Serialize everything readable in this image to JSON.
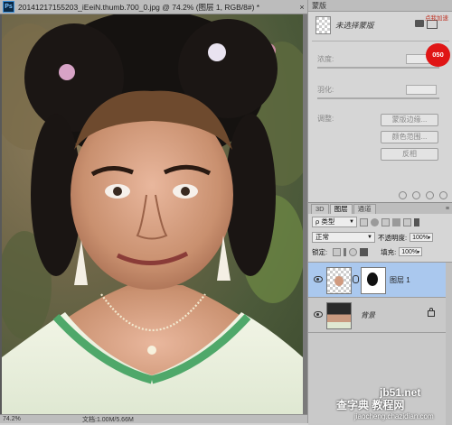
{
  "document": {
    "title": "20141217155203_iEeiN.thumb.700_0.jpg @ 74.2% (图层 1, RGB/8#) *",
    "zoom": "74.2%",
    "doc_info": "文档:1.00M/5.66M"
  },
  "properties": {
    "header": "蒙版",
    "mask_status": "未选择蒙版",
    "density_label": "浓度:",
    "feather_label": "羽化:",
    "adjust_label": "调整:",
    "buttons": [
      "蒙版边缘...",
      "颜色范围...",
      "反相"
    ]
  },
  "badge": {
    "label": "点我加速",
    "value": "050"
  },
  "layers": {
    "tabs": [
      "3D",
      "图层",
      "通道"
    ],
    "filter_kind": "类型",
    "blend_mode": "正常",
    "opacity_label": "不透明度:",
    "opacity_value": "100%",
    "lock_label": "锁定:",
    "fill_label": "填充:",
    "fill_value": "100%",
    "items": [
      {
        "name": "图层 1",
        "selected": true
      },
      {
        "name": "背景",
        "selected": false
      }
    ]
  },
  "watermark": {
    "site": "jb51.net",
    "chinese": "查字典 教程网",
    "url": "jiaocheng.chazidian.com"
  },
  "colors": {
    "accent_selected": "#aac8ee",
    "badge_red": "#e01515"
  }
}
